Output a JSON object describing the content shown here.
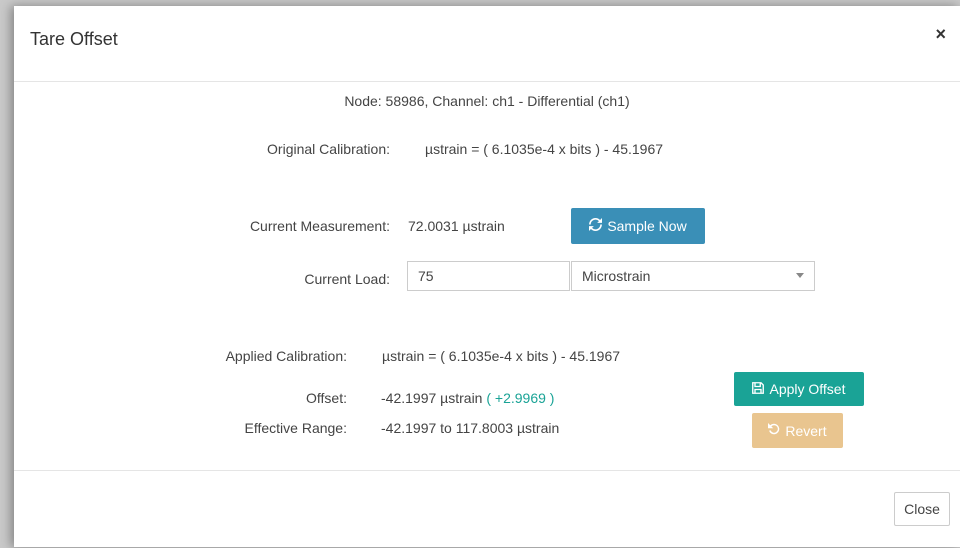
{
  "dialog": {
    "title": "Tare Offset",
    "close_symbol": "×"
  },
  "node_info": "Node: 58986, Channel: ch1 - Differential (ch1)",
  "original_calibration": {
    "label": "Original Calibration:",
    "value": "µstrain = ( 6.1035e-4 x bits ) - 45.1967"
  },
  "current_measurement": {
    "label": "Current Measurement:",
    "value": "72.0031 µstrain",
    "sample_button": "Sample Now",
    "sample_icon": "refresh-icon"
  },
  "current_load": {
    "label": "Current Load:",
    "value": "75",
    "unit_selected": "Microstrain"
  },
  "applied_calibration": {
    "label": "Applied Calibration:",
    "value": "µstrain = ( 6.1035e-4 x bits ) - 45.1967"
  },
  "offset": {
    "label": "Offset:",
    "value": "-42.1997 µstrain",
    "delta": "( +2.9969 )"
  },
  "effective_range": {
    "label": "Effective Range:",
    "value": "-42.1997 to 117.8003 µstrain"
  },
  "actions": {
    "apply_offset": "Apply Offset",
    "apply_icon": "save-icon",
    "revert": "Revert",
    "revert_icon": "undo-icon"
  },
  "footer": {
    "close_label": "Close"
  },
  "colors": {
    "sample_button": "#3a8fb7",
    "apply_button": "#1aa396",
    "revert_button": "#e9c58f",
    "delta_text": "#1aa396"
  }
}
